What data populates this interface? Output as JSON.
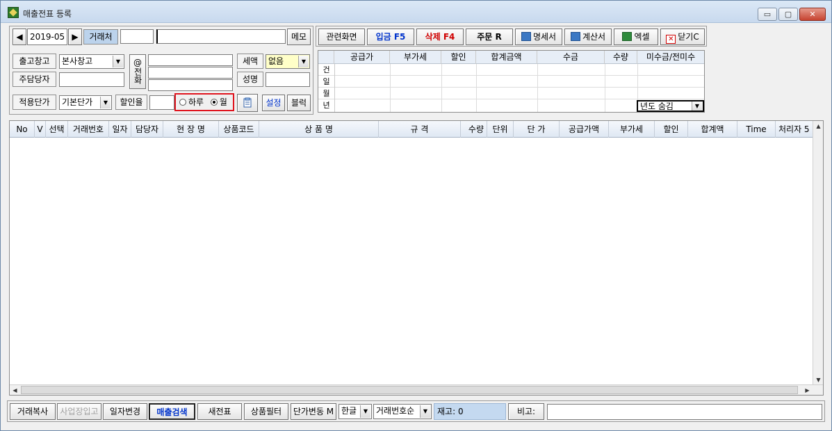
{
  "window": {
    "title": "매출전표 등록",
    "controls": {
      "minimize": "▭",
      "maximize": "▢",
      "close": "✕"
    }
  },
  "period": {
    "prev_icon": "◀",
    "value": "2019-05",
    "next_icon": "▶"
  },
  "customer": {
    "label": "거래처",
    "code": "",
    "name": "",
    "memo_button": "메모"
  },
  "warehouse": {
    "label": "출고창고",
    "value": "본사창고"
  },
  "manager": {
    "label": "주담당자",
    "value": ""
  },
  "phone": {
    "label": "전화",
    "icon": "@",
    "line1": "",
    "line2": "",
    "line3": ""
  },
  "tax": {
    "label": "세액",
    "value": "없음"
  },
  "salutation": {
    "label": "성명",
    "value": ""
  },
  "price_type": {
    "label": "적용단가",
    "value": "기본단가"
  },
  "discount_rate": {
    "label": "할인율",
    "value": ""
  },
  "range_radio": {
    "day": "하루",
    "month": "월",
    "selected": "month"
  },
  "tools": {
    "settings": "설정",
    "block": "블럭"
  },
  "toolbar": {
    "related": "관련화면",
    "deposit": "입금 F5",
    "delete": "삭제 F4",
    "order": "주문 R",
    "statement": "명세서",
    "invoice": "계산서",
    "excel": "엑셀",
    "close": "닫기C"
  },
  "summary": {
    "columns": [
      "공급가",
      "부가세",
      "할인",
      "합계금액",
      "수금",
      "수량",
      "미수금/전미수"
    ],
    "rows": [
      "건",
      "일",
      "월",
      "년"
    ],
    "year_dropdown": "년도 숨김"
  },
  "grid": {
    "columns": [
      "No",
      "V",
      "선택",
      "거래번호",
      "일자",
      "담당자",
      "현 장 명",
      "상품코드",
      "상 품 명",
      "규 격",
      "수량",
      "단위",
      "단 가",
      "공급가액",
      "부가세",
      "할인",
      "합계액",
      "Time",
      "처리자 5"
    ],
    "rows": []
  },
  "bottom": {
    "copy": "거래복사",
    "branch_in": "사업장입고",
    "date_change": "일자변경",
    "sales_search": "매출검색",
    "new_slip": "새전표",
    "product_filter": "상품필터",
    "price_change": "단가변동 M",
    "lang_select": "한글",
    "sort_select": "거래번호순",
    "stock": "재고: 0",
    "note_label": "비고:",
    "note_value": ""
  }
}
